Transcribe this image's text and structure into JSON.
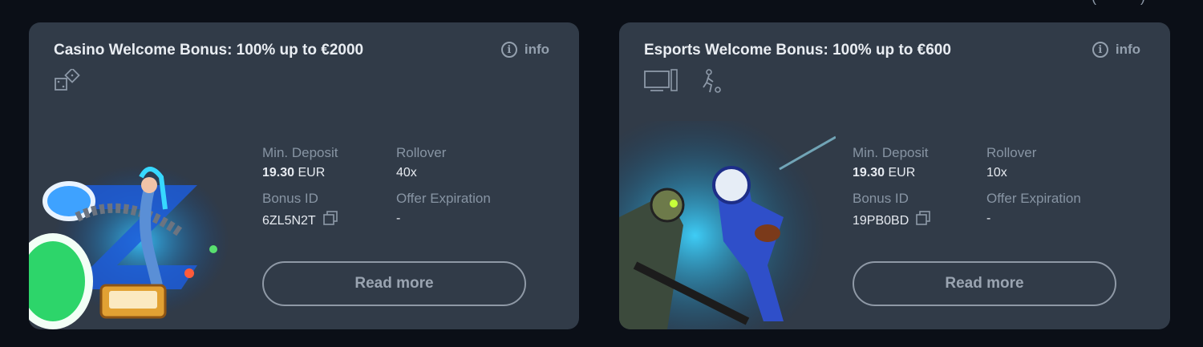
{
  "cards": [
    {
      "title": "Casino Welcome Bonus: 100% up to €2000",
      "info_label": "info",
      "category_icons": [
        "dice-icon"
      ],
      "min_deposit_label": "Min. Deposit",
      "min_deposit_amount": "19.30",
      "min_deposit_currency": "EUR",
      "rollover_label": "Rollover",
      "rollover_value": "40x",
      "bonus_id_label": "Bonus ID",
      "bonus_id_value": "6ZL5N2T",
      "expiration_label": "Offer Expiration",
      "expiration_value": "-",
      "read_more_label": "Read more"
    },
    {
      "title": "Esports Welcome Bonus: 100% up to €600",
      "info_label": "info",
      "category_icons": [
        "computer-icon",
        "sport-player-icon"
      ],
      "min_deposit_label": "Min. Deposit",
      "min_deposit_amount": "19.30",
      "min_deposit_currency": "EUR",
      "rollover_label": "Rollover",
      "rollover_value": "10x",
      "bonus_id_label": "Bonus ID",
      "bonus_id_value": "19PB0BD",
      "expiration_label": "Offer Expiration",
      "expiration_value": "-",
      "read_more_label": "Read more"
    }
  ],
  "colors": {
    "page_bg": "#0b0f17",
    "card_bg": "#313b48",
    "label": "#8794a3",
    "value": "#e6eaf0",
    "button_border": "#8f99a6"
  }
}
